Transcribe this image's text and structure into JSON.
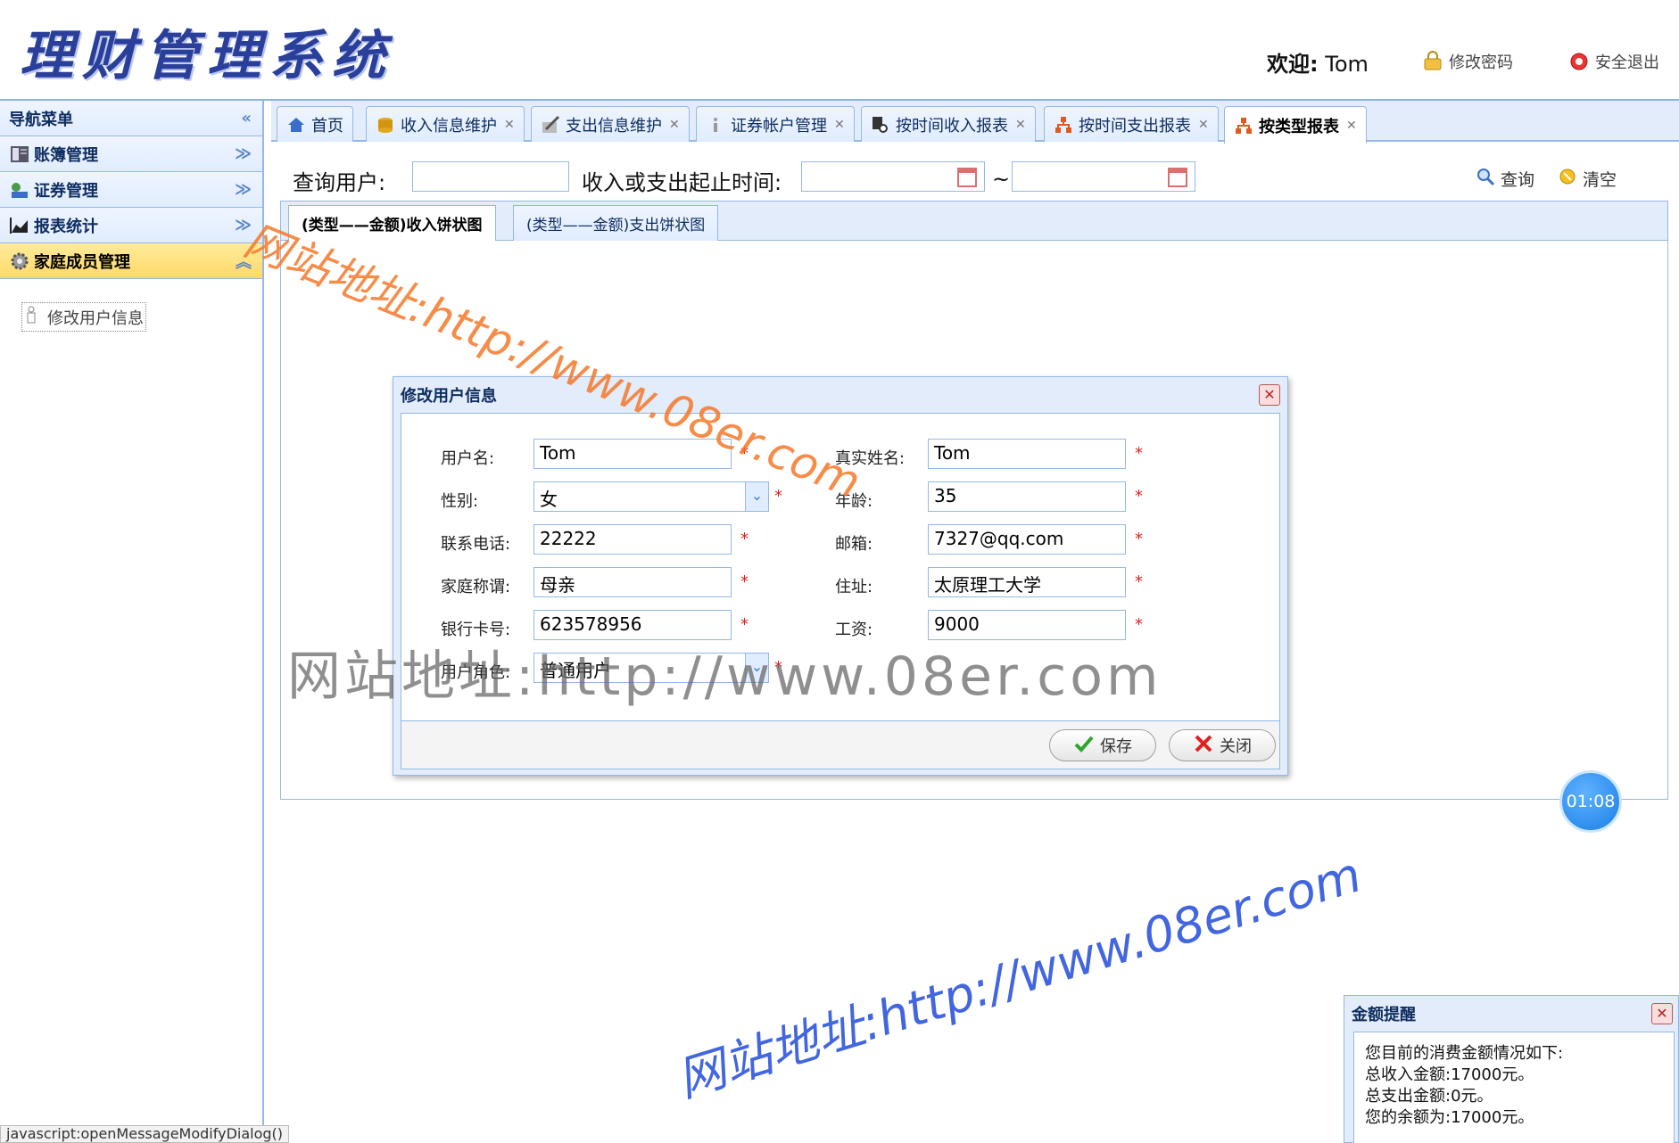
{
  "header": {
    "logo": "理财管理系统",
    "welcome_label": "欢迎:",
    "user": "Tom",
    "change_password": "修改密码",
    "logout": "安全退出"
  },
  "nav": {
    "title": "导航菜单",
    "items": [
      {
        "label": "账簿管理",
        "icon": "ledger-icon"
      },
      {
        "label": "证券管理",
        "icon": "securities-icon"
      },
      {
        "label": "报表统计",
        "icon": "chart-icon"
      },
      {
        "label": "家庭成员管理",
        "icon": "gear-icon"
      }
    ],
    "sub_item": "修改用户信息"
  },
  "tabs": [
    {
      "label": "首页",
      "closable": false
    },
    {
      "label": "收入信息维护",
      "closable": true
    },
    {
      "label": "支出信息维护",
      "closable": true
    },
    {
      "label": "证券帐户管理",
      "closable": true
    },
    {
      "label": "按时间收入报表",
      "closable": true
    },
    {
      "label": "按时间支出报表",
      "closable": true
    },
    {
      "label": "按类型报表",
      "closable": true
    }
  ],
  "query": {
    "user_label": "查询用户:",
    "user_value": "",
    "range_label": "收入或支出起止时间:",
    "tilde": "~",
    "search": "查询",
    "clear": "清空"
  },
  "inner_tabs": [
    "(类型——金额)收入饼状图",
    "(类型——金额)支出饼状图"
  ],
  "dialog": {
    "title": "修改用户信息",
    "fields": {
      "username": {
        "label": "用户名:",
        "value": "Tom"
      },
      "realname": {
        "label": "真实姓名:",
        "value": "Tom"
      },
      "gender": {
        "label": "性别:",
        "value": "女"
      },
      "age": {
        "label": "年龄:",
        "value": "35"
      },
      "phone": {
        "label": "联系电话:",
        "value": "22222"
      },
      "email": {
        "label": "邮箱:",
        "value": "7327@qq.com"
      },
      "relation": {
        "label": "家庭称谓:",
        "value": "母亲"
      },
      "address": {
        "label": "住址:",
        "value": "太原理工大学"
      },
      "bankcard": {
        "label": "银行卡号:",
        "value": "623578956"
      },
      "salary": {
        "label": "工资:",
        "value": "9000"
      },
      "role": {
        "label": "用户角色:",
        "value": "普通用户"
      }
    },
    "required_mark": "*",
    "save": "保存",
    "close": "关闭"
  },
  "timer": "01:08",
  "reminder": {
    "title": "金额提醒",
    "lines": [
      "您目前的消费金额情况如下:",
      "总收入金额:17000元。",
      "总支出金额:0元。",
      "您的余额为:17000元。"
    ]
  },
  "status_bar": "javascript:openMessageModifyDialog()",
  "watermarks": [
    "网站地址:http://www.08er.com",
    "网站地址:http://www.08er.com",
    "网站地址:http://www.08er.com"
  ],
  "colors": {
    "accent_border": "#95b8e7",
    "panel_bg": "#e3ecfa",
    "active_nav": "#ffd968",
    "required": "#e02020"
  }
}
